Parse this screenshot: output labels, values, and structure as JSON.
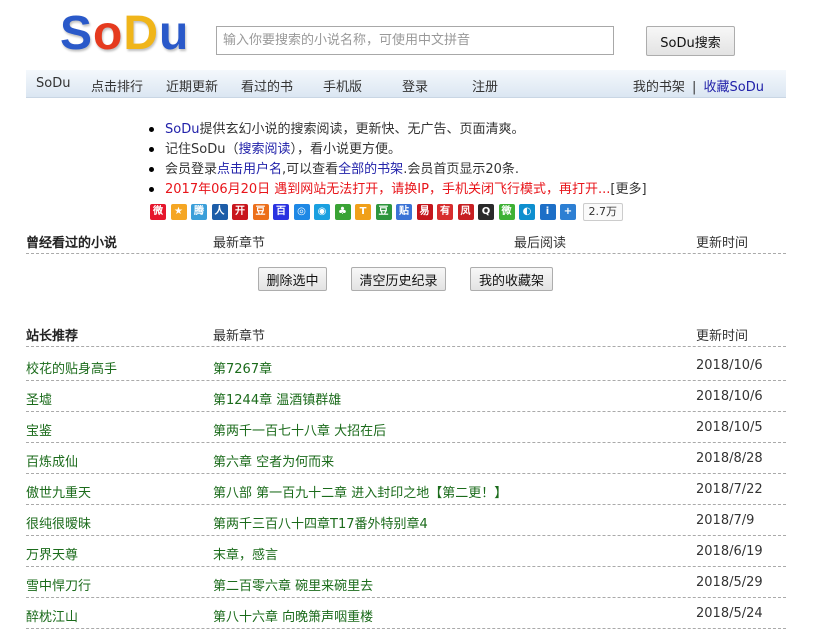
{
  "logo": {
    "letters": [
      "S",
      "o",
      "D",
      "u"
    ]
  },
  "search": {
    "placeholder": "输入你要搜索的小说名称，可使用中文拼音",
    "button_label": "SoDu搜索"
  },
  "nav": {
    "items": [
      "SoDu",
      "点击排行",
      "近期更新",
      "看过的书",
      "手机版",
      "登录",
      "注册"
    ],
    "bookshelf": "我的书架",
    "separator": "|",
    "favorite": "收藏SoDu"
  },
  "notices": {
    "line1_brand": "SoDu",
    "line1_text": "提供玄幻小说的搜索阅读，更新快、无广告、页面清爽。",
    "line2_pre": "记住SoDu（",
    "line2_link": "搜索阅读",
    "line2_post": "），看小说更方便。",
    "line3_pre": "会员登录",
    "line3_link1": "点击用户名",
    "line3_mid": ",可以查看",
    "line3_link2": "全部的书架",
    "line3_post": ".会员首页显示20条.",
    "line4_red": "2017年06月20日 遇到网站无法打开，请换IP，手机关闭飞行模式，再打开...",
    "line4_more": "[更多]"
  },
  "share": {
    "icons": [
      {
        "name": "weibo-icon",
        "color": "#e6162d",
        "glyph": "微"
      },
      {
        "name": "qzone-icon",
        "color": "#f5a623",
        "glyph": "★"
      },
      {
        "name": "tencent-weibo-icon",
        "color": "#3b9fd9",
        "glyph": "腾"
      },
      {
        "name": "renren-icon",
        "color": "#1d5da8",
        "glyph": "人"
      },
      {
        "name": "kaixin-icon",
        "color": "#c8161d",
        "glyph": "开"
      },
      {
        "name": "douban-icon",
        "color": "#ec6f1a",
        "glyph": "豆"
      },
      {
        "name": "baidu-icon",
        "color": "#2932e1",
        "glyph": "百"
      },
      {
        "name": "sohu-icon",
        "color": "#1e88e5",
        "glyph": "◎"
      },
      {
        "name": "pengyou-icon",
        "color": "#1aa0e0",
        "glyph": "◉"
      },
      {
        "name": "clover-icon",
        "color": "#3aa335",
        "glyph": "♣"
      },
      {
        "name": "taobao-icon",
        "color": "#f0a01a",
        "glyph": "T"
      },
      {
        "name": "douban-green-icon",
        "color": "#2e963d",
        "glyph": "豆"
      },
      {
        "name": "tieba-icon",
        "color": "#3b73d6",
        "glyph": "贴"
      },
      {
        "name": "163-icon",
        "color": "#c4161c",
        "glyph": "易"
      },
      {
        "name": "youdao-icon",
        "color": "#d72e2e",
        "glyph": "有"
      },
      {
        "name": "ifeng-icon",
        "color": "#c71f22",
        "glyph": "凤"
      },
      {
        "name": "qq-icon",
        "color": "#2a2a2a",
        "glyph": "Q"
      },
      {
        "name": "wechat-icon",
        "color": "#3eb135",
        "glyph": "微"
      },
      {
        "name": "evernote-icon",
        "color": "#0e8fcf",
        "glyph": "◐"
      },
      {
        "name": "info-icon",
        "color": "#1d6fc7",
        "glyph": "i"
      },
      {
        "name": "more-plus-icon",
        "color": "#2d7fd3",
        "glyph": "+"
      }
    ],
    "count": "2.7万"
  },
  "history": {
    "headers": [
      "曾经看过的小说",
      "最新章节",
      "最后阅读",
      "更新时间"
    ],
    "buttons": [
      "删除选中",
      "清空历史纪录",
      "我的收藏架"
    ]
  },
  "recommend": {
    "headers": [
      "站长推荐",
      "最新章节",
      "更新时间"
    ],
    "rows": [
      {
        "novel": "校花的贴身高手",
        "chapter": "第7267章",
        "date": "2018/10/6"
      },
      {
        "novel": "圣墟",
        "chapter": "第1244章 温酒镇群雄",
        "date": "2018/10/6"
      },
      {
        "novel": "宝鉴",
        "chapter": "第两千一百七十八章 大招在后",
        "date": "2018/10/5"
      },
      {
        "novel": "百炼成仙",
        "chapter": "第六章 空者为何而来",
        "date": "2018/8/28"
      },
      {
        "novel": "傲世九重天",
        "chapter": "第八部 第一百九十二章 进入封印之地【第二更！】",
        "date": "2018/7/22"
      },
      {
        "novel": "很纯很暧昧",
        "chapter": "第两千三百八十四章T17番外特别章4",
        "date": "2018/7/9"
      },
      {
        "novel": "万界天尊",
        "chapter": "末章，感言",
        "date": "2018/6/19"
      },
      {
        "novel": "雪中悍刀行",
        "chapter": "第二百零六章 碗里来碗里去",
        "date": "2018/5/29"
      },
      {
        "novel": "醉枕江山",
        "chapter": "第八十六章 向晚箫声咽重楼",
        "date": "2018/5/24"
      }
    ]
  },
  "colors": {
    "logo": [
      "#2a59c9",
      "#e53a1e",
      "#f0b51a",
      "#2a59c9"
    ],
    "link_green": "#1b6b1b",
    "link_blue": "#2222aa",
    "notice_red": "#e8141a"
  }
}
